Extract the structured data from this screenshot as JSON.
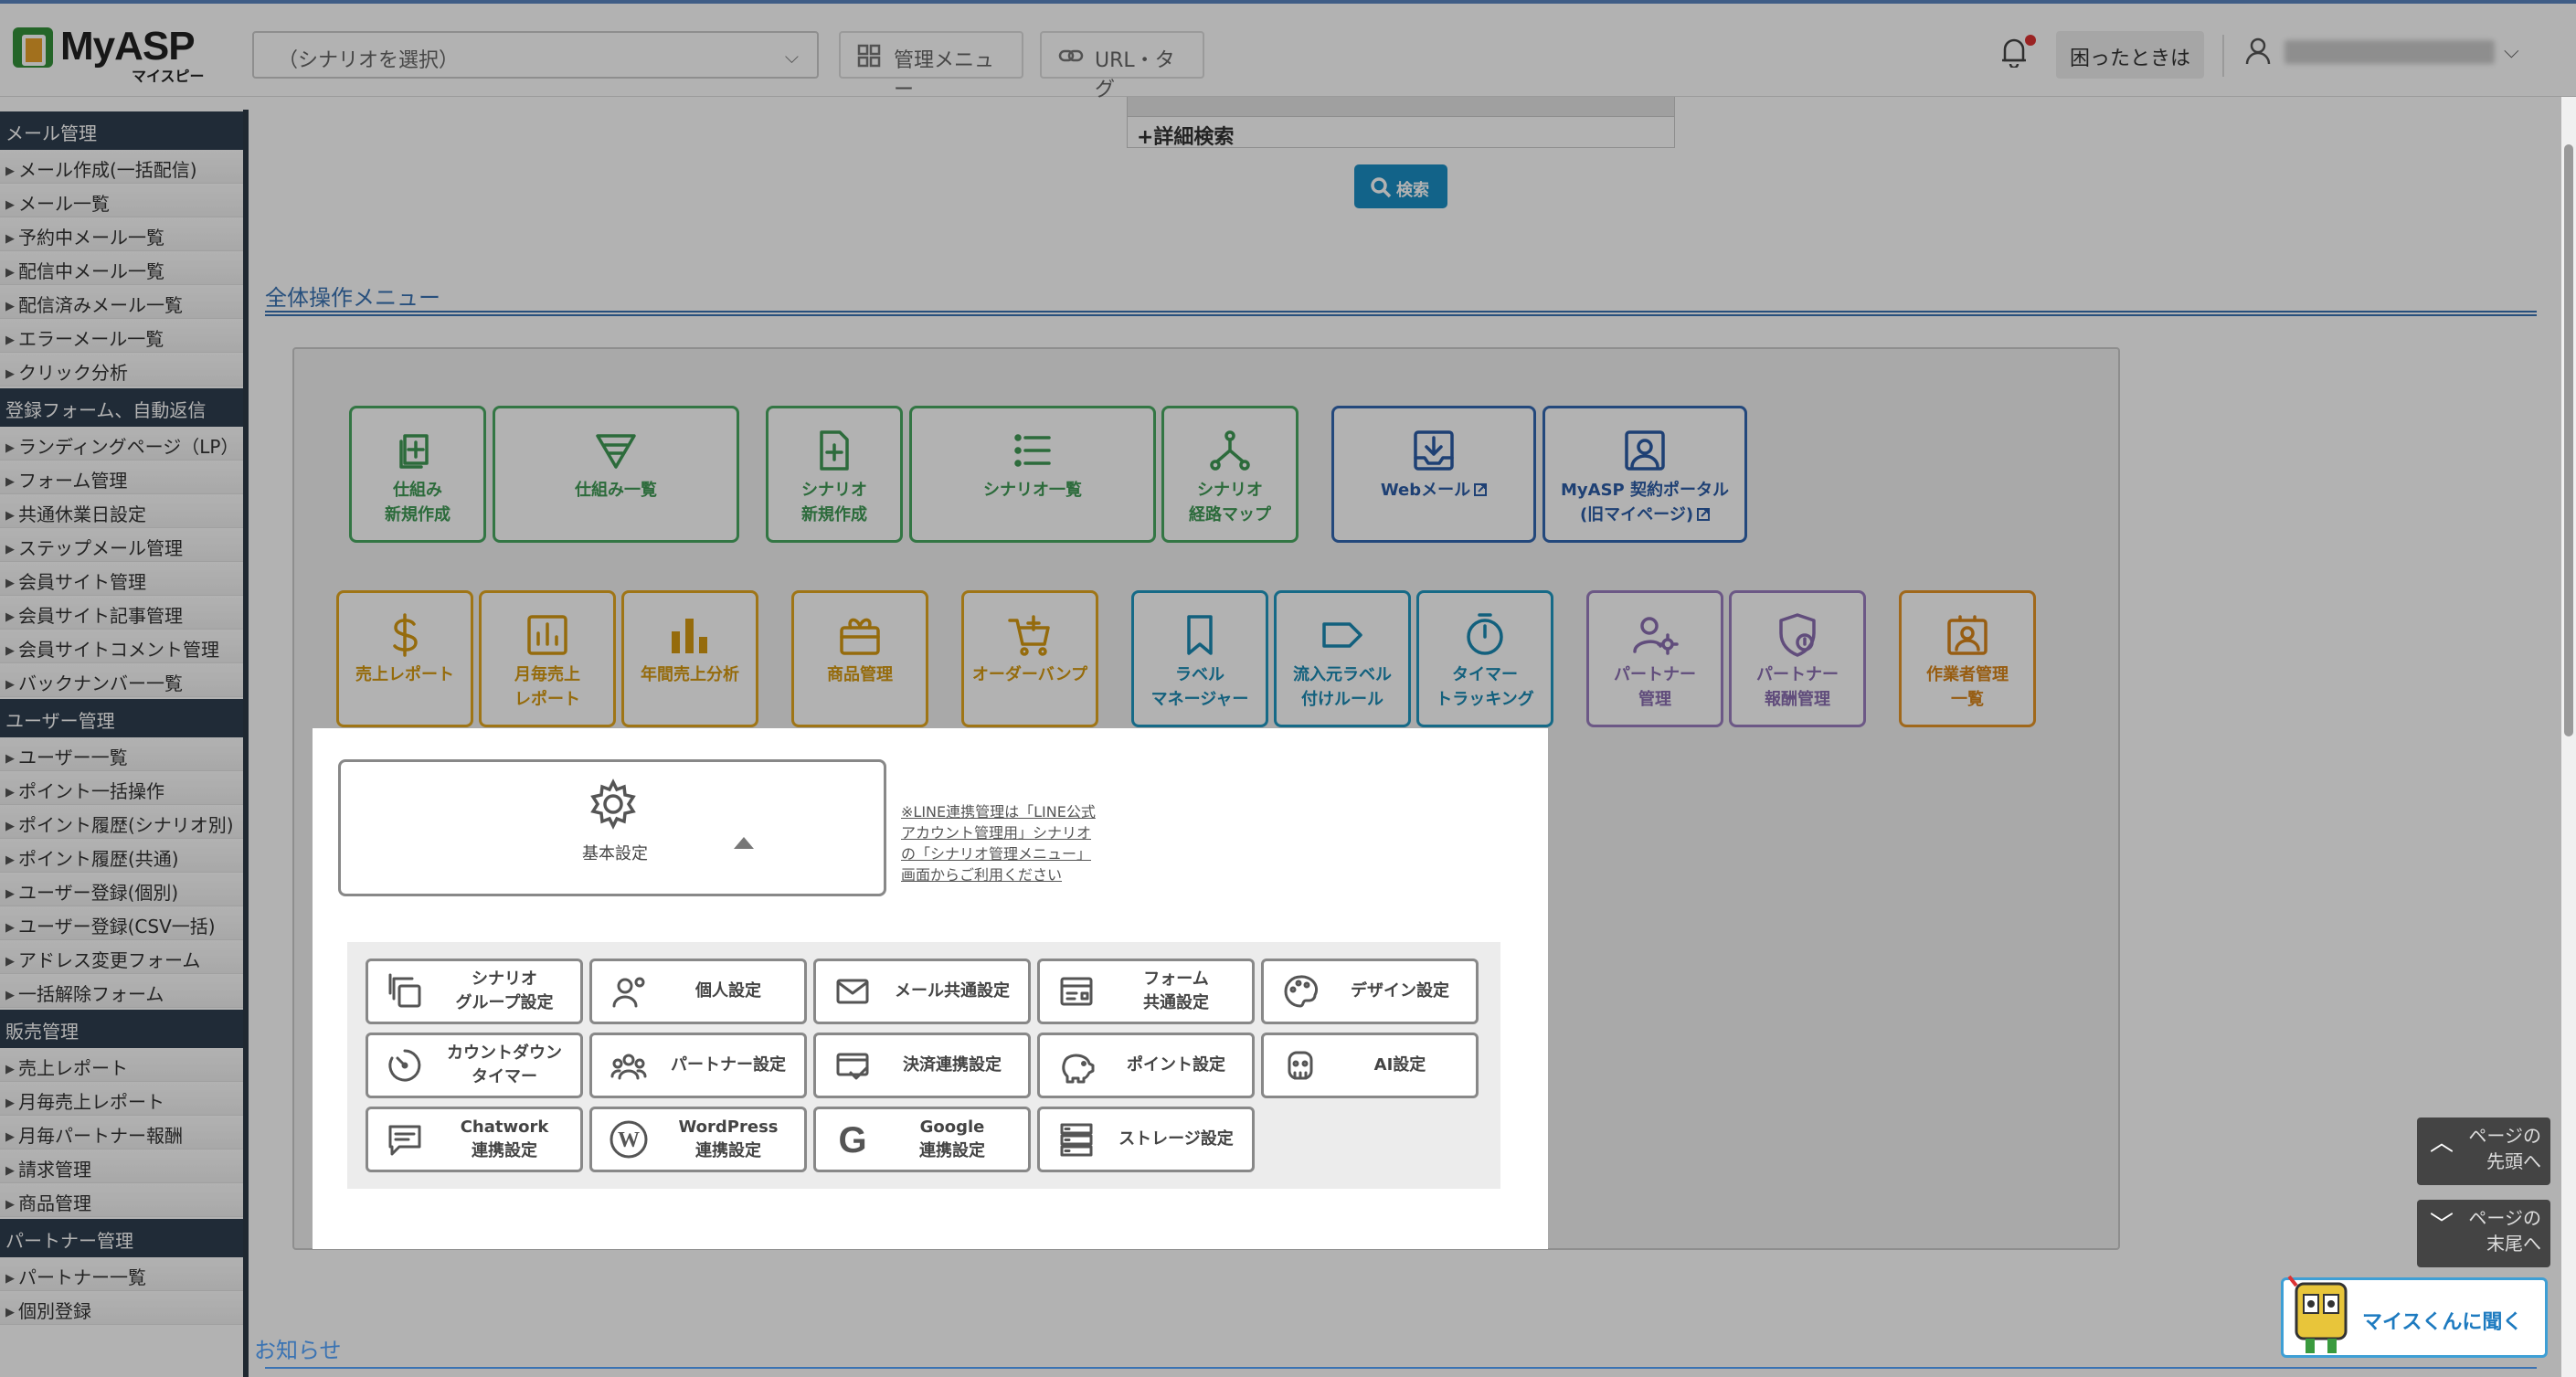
{
  "header": {
    "logo_main": "MyASP",
    "logo_sub": "マイスピー",
    "scenario_select": "（シナリオを選択）",
    "admin_menu": "管理メニュー",
    "url_tag": "URL・タグ",
    "help": "困ったときは"
  },
  "sidebar": {
    "sections": [
      {
        "title": "メール管理",
        "items": [
          "メール作成(一括配信)",
          "メール一覧",
          "予約中メール一覧",
          "配信中メール一覧",
          "配信済みメール一覧",
          "エラーメール一覧",
          "クリック分析"
        ]
      },
      {
        "title": "登録フォーム、自動返信",
        "items": [
          "ランディングページ（LP）",
          "フォーム管理",
          "共通休業日設定",
          "ステップメール管理",
          "会員サイト管理",
          "会員サイト記事管理",
          "会員サイトコメント管理",
          "バックナンバー一覧"
        ]
      },
      {
        "title": "ユーザー管理",
        "items": [
          "ユーザー一覧",
          "ポイント一括操作",
          "ポイント履歴(シナリオ別)",
          "ポイント履歴(共通)",
          "ユーザー登録(個別)",
          "ユーザー登録(CSV一括)",
          "アドレス変更フォーム",
          "一括解除フォーム"
        ]
      },
      {
        "title": "販売管理",
        "items": [
          "売上レポート",
          "月毎売上レポート",
          "月毎パートナー報酬",
          "請求管理",
          "商品管理"
        ]
      },
      {
        "title": "パートナー管理",
        "items": [
          "パートナー一覧",
          "個別登録"
        ]
      }
    ]
  },
  "search": {
    "detail": "+詳細検索",
    "button": "検索"
  },
  "section_title": "全体操作メニュー",
  "tiles": {
    "t1": "仕組み\n新規作成",
    "t2": "仕組み一覧",
    "t3": "シナリオ\n新規作成",
    "t4": "シナリオ一覧",
    "t5": "シナリオ\n経路マップ",
    "t6": "Webメール",
    "t7": "MyASP 契約ポータル\n(旧マイページ)",
    "t8": "売上レポート",
    "t9": "月毎売上\nレポート",
    "t10": "年間売上分析",
    "t11": "商品管理",
    "t12": "オーダーバンプ",
    "t13": "ラベル\nマネージャー",
    "t14": "流入元ラベル\n付けルール",
    "t15": "タイマー\nトラッキング",
    "t16": "パートナー\n管理",
    "t17": "パートナー\n報酬管理",
    "t18": "作業者管理\n一覧"
  },
  "basic": {
    "label": "基本設定",
    "note": "※LINE連携管理は「LINE公式アカウント管理用」シナリオの「シナリオ管理メニュー」画面からご利用ください"
  },
  "settings": [
    "シナリオ\nグループ設定",
    "個人設定",
    "メール共通設定",
    "フォーム\n共通設定",
    "デザイン設定",
    "カウントダウン\nタイマー",
    "パートナー設定",
    "決済連携設定",
    "ポイント設定",
    "AI設定",
    "Chatwork\n連携設定",
    "WordPress\n連携設定",
    "Google\n連携設定",
    "ストレージ設定"
  ],
  "float": {
    "top": "ページの\n先頭へ",
    "bottom": "ページの\n末尾へ",
    "ai": "マイスくんに聞く"
  },
  "news_title": "お知らせ",
  "colors": {
    "accent": "#3a73b3",
    "search_button": "#1a8fc4",
    "highlight": "#f2a7c6",
    "sidebar_header": "#2f3e4f"
  }
}
